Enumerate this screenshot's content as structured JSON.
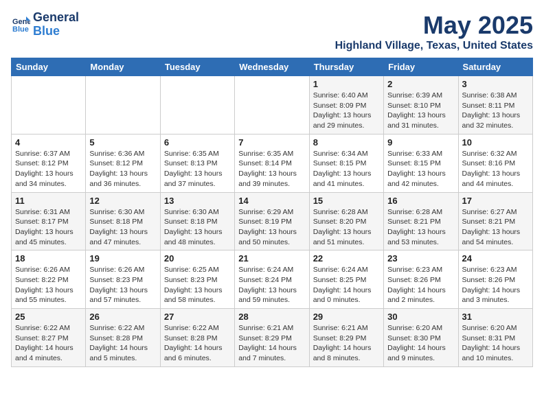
{
  "header": {
    "logo_line1": "General",
    "logo_line2": "Blue",
    "month": "May 2025",
    "location": "Highland Village, Texas, United States"
  },
  "weekdays": [
    "Sunday",
    "Monday",
    "Tuesday",
    "Wednesday",
    "Thursday",
    "Friday",
    "Saturday"
  ],
  "weeks": [
    [
      {
        "num": "",
        "info": ""
      },
      {
        "num": "",
        "info": ""
      },
      {
        "num": "",
        "info": ""
      },
      {
        "num": "",
        "info": ""
      },
      {
        "num": "1",
        "info": "Sunrise: 6:40 AM\nSunset: 8:09 PM\nDaylight: 13 hours\nand 29 minutes."
      },
      {
        "num": "2",
        "info": "Sunrise: 6:39 AM\nSunset: 8:10 PM\nDaylight: 13 hours\nand 31 minutes."
      },
      {
        "num": "3",
        "info": "Sunrise: 6:38 AM\nSunset: 8:11 PM\nDaylight: 13 hours\nand 32 minutes."
      }
    ],
    [
      {
        "num": "4",
        "info": "Sunrise: 6:37 AM\nSunset: 8:12 PM\nDaylight: 13 hours\nand 34 minutes."
      },
      {
        "num": "5",
        "info": "Sunrise: 6:36 AM\nSunset: 8:12 PM\nDaylight: 13 hours\nand 36 minutes."
      },
      {
        "num": "6",
        "info": "Sunrise: 6:35 AM\nSunset: 8:13 PM\nDaylight: 13 hours\nand 37 minutes."
      },
      {
        "num": "7",
        "info": "Sunrise: 6:35 AM\nSunset: 8:14 PM\nDaylight: 13 hours\nand 39 minutes."
      },
      {
        "num": "8",
        "info": "Sunrise: 6:34 AM\nSunset: 8:15 PM\nDaylight: 13 hours\nand 41 minutes."
      },
      {
        "num": "9",
        "info": "Sunrise: 6:33 AM\nSunset: 8:15 PM\nDaylight: 13 hours\nand 42 minutes."
      },
      {
        "num": "10",
        "info": "Sunrise: 6:32 AM\nSunset: 8:16 PM\nDaylight: 13 hours\nand 44 minutes."
      }
    ],
    [
      {
        "num": "11",
        "info": "Sunrise: 6:31 AM\nSunset: 8:17 PM\nDaylight: 13 hours\nand 45 minutes."
      },
      {
        "num": "12",
        "info": "Sunrise: 6:30 AM\nSunset: 8:18 PM\nDaylight: 13 hours\nand 47 minutes."
      },
      {
        "num": "13",
        "info": "Sunrise: 6:30 AM\nSunset: 8:18 PM\nDaylight: 13 hours\nand 48 minutes."
      },
      {
        "num": "14",
        "info": "Sunrise: 6:29 AM\nSunset: 8:19 PM\nDaylight: 13 hours\nand 50 minutes."
      },
      {
        "num": "15",
        "info": "Sunrise: 6:28 AM\nSunset: 8:20 PM\nDaylight: 13 hours\nand 51 minutes."
      },
      {
        "num": "16",
        "info": "Sunrise: 6:28 AM\nSunset: 8:21 PM\nDaylight: 13 hours\nand 53 minutes."
      },
      {
        "num": "17",
        "info": "Sunrise: 6:27 AM\nSunset: 8:21 PM\nDaylight: 13 hours\nand 54 minutes."
      }
    ],
    [
      {
        "num": "18",
        "info": "Sunrise: 6:26 AM\nSunset: 8:22 PM\nDaylight: 13 hours\nand 55 minutes."
      },
      {
        "num": "19",
        "info": "Sunrise: 6:26 AM\nSunset: 8:23 PM\nDaylight: 13 hours\nand 57 minutes."
      },
      {
        "num": "20",
        "info": "Sunrise: 6:25 AM\nSunset: 8:23 PM\nDaylight: 13 hours\nand 58 minutes."
      },
      {
        "num": "21",
        "info": "Sunrise: 6:24 AM\nSunset: 8:24 PM\nDaylight: 13 hours\nand 59 minutes."
      },
      {
        "num": "22",
        "info": "Sunrise: 6:24 AM\nSunset: 8:25 PM\nDaylight: 14 hours\nand 0 minutes."
      },
      {
        "num": "23",
        "info": "Sunrise: 6:23 AM\nSunset: 8:26 PM\nDaylight: 14 hours\nand 2 minutes."
      },
      {
        "num": "24",
        "info": "Sunrise: 6:23 AM\nSunset: 8:26 PM\nDaylight: 14 hours\nand 3 minutes."
      }
    ],
    [
      {
        "num": "25",
        "info": "Sunrise: 6:22 AM\nSunset: 8:27 PM\nDaylight: 14 hours\nand 4 minutes."
      },
      {
        "num": "26",
        "info": "Sunrise: 6:22 AM\nSunset: 8:28 PM\nDaylight: 14 hours\nand 5 minutes."
      },
      {
        "num": "27",
        "info": "Sunrise: 6:22 AM\nSunset: 8:28 PM\nDaylight: 14 hours\nand 6 minutes."
      },
      {
        "num": "28",
        "info": "Sunrise: 6:21 AM\nSunset: 8:29 PM\nDaylight: 14 hours\nand 7 minutes."
      },
      {
        "num": "29",
        "info": "Sunrise: 6:21 AM\nSunset: 8:29 PM\nDaylight: 14 hours\nand 8 minutes."
      },
      {
        "num": "30",
        "info": "Sunrise: 6:20 AM\nSunset: 8:30 PM\nDaylight: 14 hours\nand 9 minutes."
      },
      {
        "num": "31",
        "info": "Sunrise: 6:20 AM\nSunset: 8:31 PM\nDaylight: 14 hours\nand 10 minutes."
      }
    ]
  ]
}
